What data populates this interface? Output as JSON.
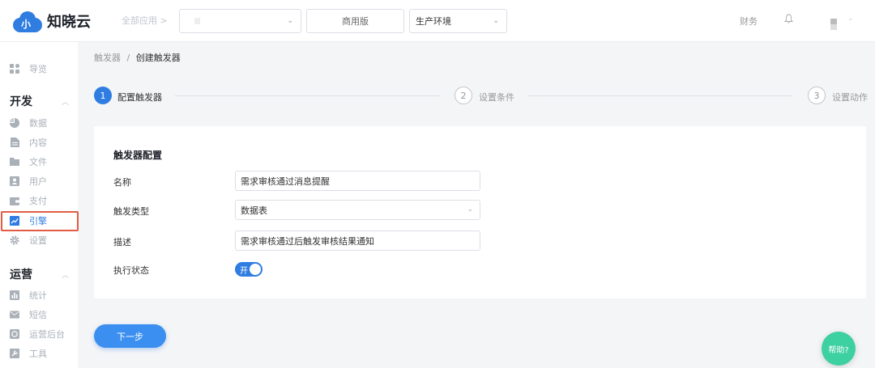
{
  "header": {
    "logo_text": "知晓云",
    "logo_glyph": "小",
    "all_apps": "全部应用 >",
    "edition": "商用版",
    "environment": "生产环境",
    "finance": "财务"
  },
  "sidebar": {
    "items_top": [
      {
        "label": "导览",
        "icon": "grid-icon"
      }
    ],
    "dev_group": "开发",
    "dev_items": [
      {
        "label": "数据",
        "icon": "pie-chart-icon"
      },
      {
        "label": "内容",
        "icon": "document-icon"
      },
      {
        "label": "文件",
        "icon": "folder-icon"
      },
      {
        "label": "用户",
        "icon": "user-icon"
      },
      {
        "label": "支付",
        "icon": "wallet-icon"
      },
      {
        "label": "引擎",
        "icon": "chart-trend-icon"
      },
      {
        "label": "设置",
        "icon": "gear-icon"
      }
    ],
    "ops_group": "运营",
    "ops_items": [
      {
        "label": "统计",
        "icon": "bar-chart-icon"
      },
      {
        "label": "短信",
        "icon": "mail-icon"
      },
      {
        "label": "运营后台",
        "icon": "console-icon"
      },
      {
        "label": "工具",
        "icon": "wrench-icon"
      }
    ]
  },
  "breadcrumb": {
    "parent": "触发器",
    "separator": "/",
    "current": "创建触发器"
  },
  "steps": [
    {
      "num": "1",
      "label": "配置触发器"
    },
    {
      "num": "2",
      "label": "设置条件"
    },
    {
      "num": "3",
      "label": "设置动作"
    }
  ],
  "form": {
    "title": "触发器配置",
    "name_label": "名称",
    "name_value": "需求审核通过消息提醒",
    "type_label": "触发类型",
    "type_value": "数据表",
    "desc_label": "描述",
    "desc_value": "需求审核通过后触发审核结果通知",
    "status_label": "执行状态",
    "status_toggle_text": "开"
  },
  "next_button": "下一步",
  "help_button": "帮助?",
  "colors": {
    "accent": "#2f7de1",
    "help": "#3dd0a0",
    "highlight": "#e25d44"
  }
}
